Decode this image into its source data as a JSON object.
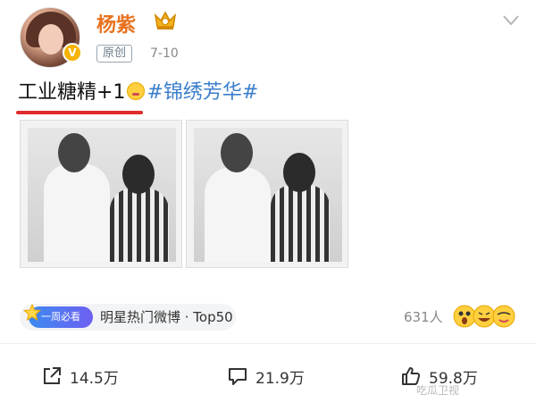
{
  "author": {
    "name": "杨紫",
    "source_tag": "原创",
    "date": "7-10"
  },
  "post": {
    "text_main": "工业糖精+1",
    "hashtag": "#锦绣芳华#"
  },
  "photos": [
    {
      "description": "polaroid-photo-1"
    },
    {
      "description": "polaroid-photo-2"
    }
  ],
  "ranking": {
    "badge": "一周必看",
    "text": "明星热门微博 · Top50"
  },
  "reactions": {
    "count_text": "631人"
  },
  "actions": {
    "share": "14.5万",
    "comment": "21.9万",
    "like": "59.8万"
  },
  "watermark": "吃瓜卫视",
  "colors": {
    "username": "#e8731f",
    "hashtag": "#3b7ecb",
    "underline": "#e02b2b"
  },
  "icons": [
    "crown-badge-icon",
    "verified-icon",
    "chevron-down-icon",
    "share-icon",
    "comment-icon",
    "like-icon"
  ]
}
